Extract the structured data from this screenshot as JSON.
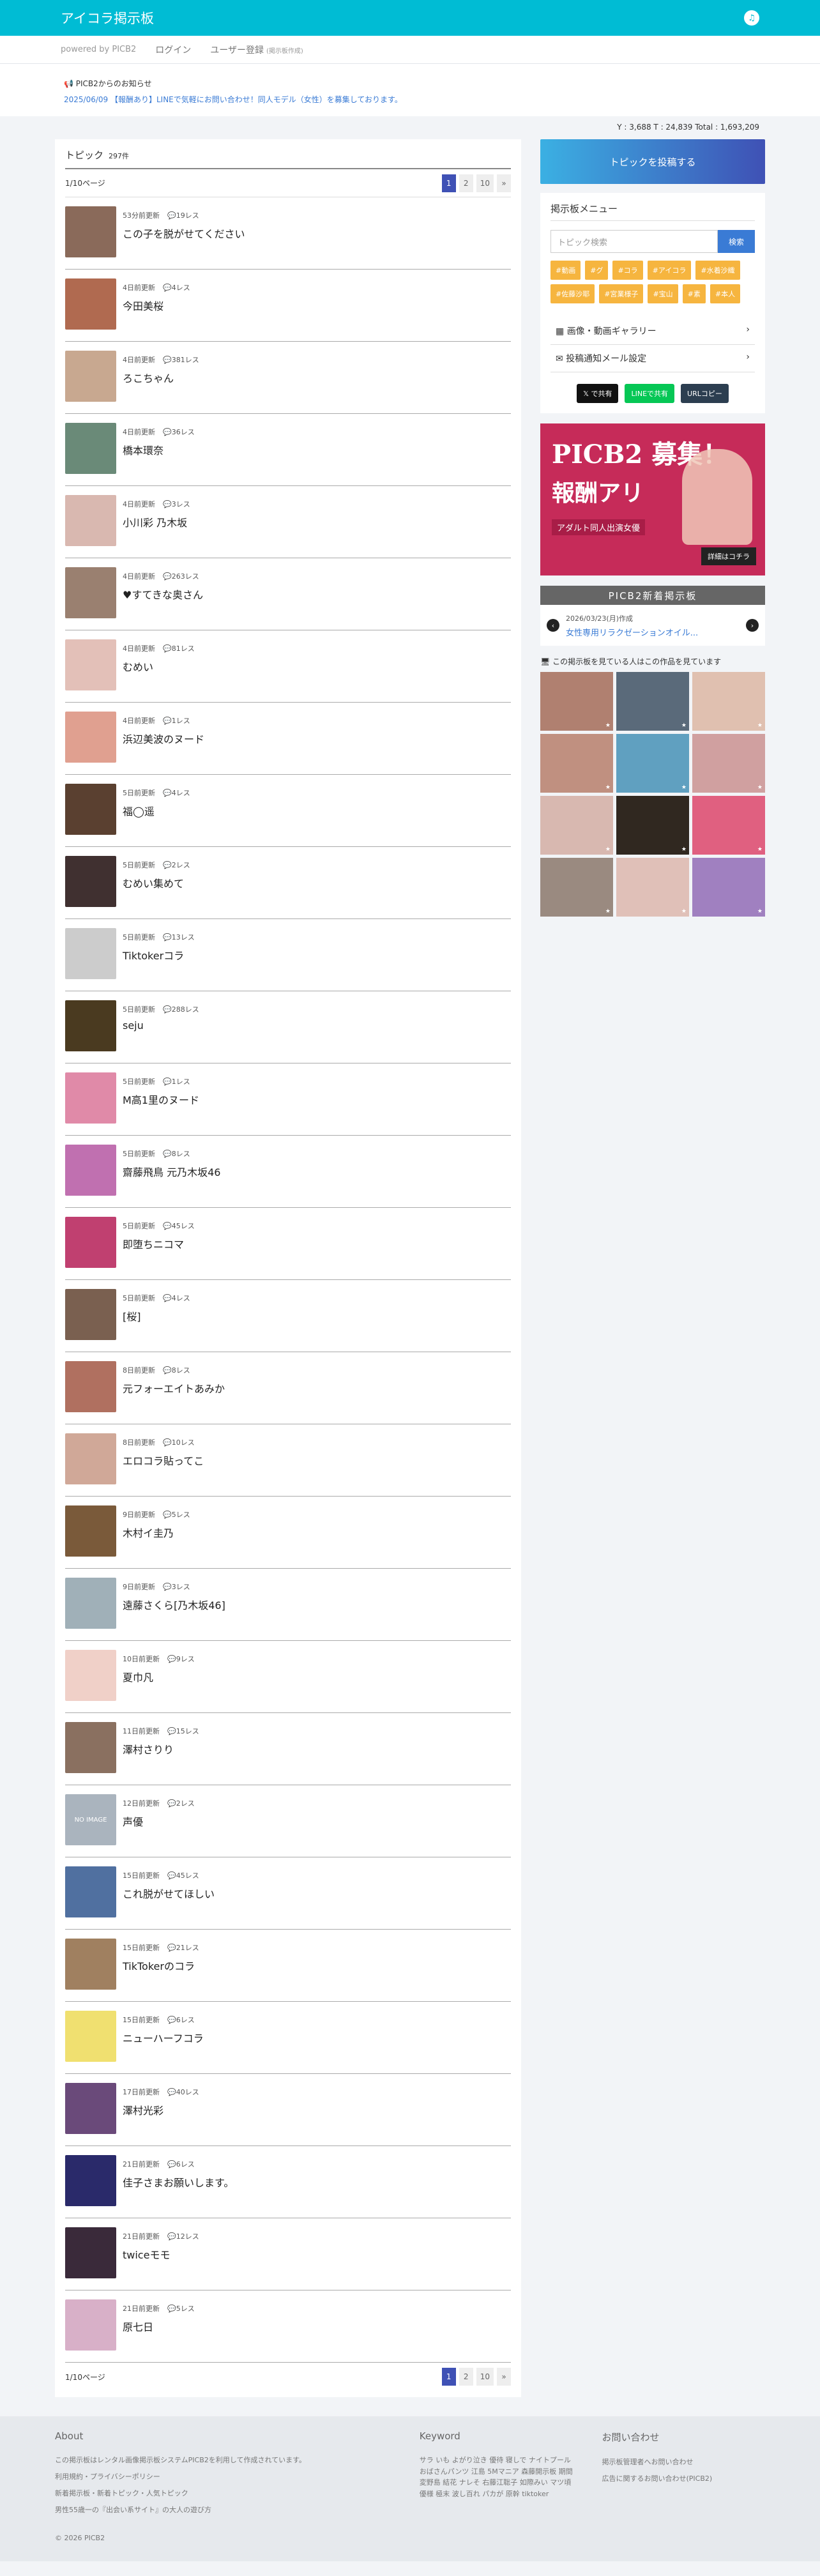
{
  "header": {
    "title": "アイコラ掲示板"
  },
  "subnav": {
    "powered": "powered by PICB2",
    "login": "ログイン",
    "register": "ユーザー登録",
    "register_note": "(掲示板作成)"
  },
  "notice": {
    "title": "PICB2からのお知らせ",
    "text": "2025/06/09 【報酬あり】LINEで気軽にお問い合わせ！同人モデル（女性）を募集しております。"
  },
  "stats": "Y : 3,688  T : 24,839  Total : 1,693,209",
  "topics": {
    "heading": "トピック",
    "count": "297件",
    "page_label": "1/10ページ",
    "pages": [
      "1",
      "2",
      "10",
      "»"
    ],
    "items": [
      {
        "meta": "53分前更新",
        "res": "19レス",
        "title": "この子を脱がせてください",
        "color": "#8a6a5a"
      },
      {
        "meta": "4日前更新",
        "res": "4レス",
        "title": "今田美桜",
        "color": "#b06a50"
      },
      {
        "meta": "4日前更新",
        "res": "381レス",
        "title": "ろこちゃん",
        "color": "#c8a890"
      },
      {
        "meta": "4日前更新",
        "res": "36レス",
        "title": "橋本環奈",
        "color": "#6a8a78"
      },
      {
        "meta": "4日前更新",
        "res": "3レス",
        "title": "小川彩 乃木坂",
        "color": "#d9b8b0"
      },
      {
        "meta": "4日前更新",
        "res": "263レス",
        "title": "♥すてきな奥さん",
        "color": "#9a8070"
      },
      {
        "meta": "4日前更新",
        "res": "81レス",
        "title": "むめい",
        "color": "#e3c0b8"
      },
      {
        "meta": "4日前更新",
        "res": "1レス",
        "title": "浜辺美波のヌード",
        "color": "#e0a090"
      },
      {
        "meta": "5日前更新",
        "res": "4レス",
        "title": "福◯遥",
        "color": "#5a4030"
      },
      {
        "meta": "5日前更新",
        "res": "2レス",
        "title": "むめい集めて",
        "color": "#403030"
      },
      {
        "meta": "5日前更新",
        "res": "13レス",
        "title": "Tiktokerコラ",
        "color": "#cccccc"
      },
      {
        "meta": "5日前更新",
        "res": "288レス",
        "title": "seju",
        "color": "#4a3a20"
      },
      {
        "meta": "5日前更新",
        "res": "1レス",
        "title": "M高1里のヌード",
        "color": "#e08aa8"
      },
      {
        "meta": "5日前更新",
        "res": "8レス",
        "title": "齋藤飛鳥 元乃木坂46",
        "color": "#c070b0"
      },
      {
        "meta": "5日前更新",
        "res": "45レス",
        "title": "即堕ちニコマ",
        "color": "#c04070"
      },
      {
        "meta": "5日前更新",
        "res": "4レス",
        "title": "[桜]",
        "color": "#7a6050"
      },
      {
        "meta": "8日前更新",
        "res": "8レス",
        "title": "元フォーエイトあみか",
        "color": "#b07060"
      },
      {
        "meta": "8日前更新",
        "res": "10レス",
        "title": "エロコラ貼ってこ",
        "color": "#d0a898"
      },
      {
        "meta": "9日前更新",
        "res": "5レス",
        "title": "木村イ圭乃",
        "color": "#7a5a3a"
      },
      {
        "meta": "9日前更新",
        "res": "3レス",
        "title": "遠藤さくら[乃木坂46]",
        "color": "#a0b0b8"
      },
      {
        "meta": "10日前更新",
        "res": "9レス",
        "title": "夏巾凡",
        "color": "#f0d0c8"
      },
      {
        "meta": "11日前更新",
        "res": "15レス",
        "title": "澤村さりり",
        "color": "#8a7060"
      },
      {
        "meta": "12日前更新",
        "res": "2レス",
        "title": "声優",
        "color": "#aab4be",
        "noimage": "NO IMAGE"
      },
      {
        "meta": "15日前更新",
        "res": "45レス",
        "title": "これ脱がせてほしい",
        "color": "#5070a0"
      },
      {
        "meta": "15日前更新",
        "res": "21レス",
        "title": "TikTokerのコラ",
        "color": "#a08060"
      },
      {
        "meta": "15日前更新",
        "res": "6レス",
        "title": "ニューハーフコラ",
        "color": "#f0e070"
      },
      {
        "meta": "17日前更新",
        "res": "40レス",
        "title": "澤村光彩",
        "color": "#6a4a7a"
      },
      {
        "meta": "21日前更新",
        "res": "6レス",
        "title": "佳子さまお願いします。",
        "color": "#2a2a6a"
      },
      {
        "meta": "21日前更新",
        "res": "12レス",
        "title": "twiceモモ",
        "color": "#3a2a3a"
      },
      {
        "meta": "21日前更新",
        "res": "5レス",
        "title": "原七日",
        "color": "#d8b0c8"
      }
    ]
  },
  "sidebar": {
    "post_button": "トピックを投稿する",
    "menu_title": "掲示板メニュー",
    "search_placeholder": "トピック検索",
    "search_button": "検索",
    "tags": [
      "#動画",
      "#グ",
      "#コラ",
      "#アイコラ",
      "#水着沙織",
      "#佐藤沙耶",
      "#宮業様子",
      "#宝山",
      "#素",
      "#本人"
    ],
    "links": [
      "画像・動画ギャラリー",
      "投稿通知メール設定"
    ],
    "shares": [
      "で共有",
      "LINEで共有",
      "URLコピー"
    ],
    "banner": {
      "line1": "PICB2 募集！",
      "line2": "報酬アリ",
      "line3": "アダルト同人出演女優",
      "cta": "詳細はコチラ"
    },
    "new_board": {
      "head": "PICB2新着掲示板",
      "date": "2026/03/23(月)作成",
      "title": "女性専用リラクゼーションオイル..."
    },
    "gallery_title": "この掲示板を見ている人はこの作品を見ています",
    "gallery_colors": [
      "#b08070",
      "#5a6a7a",
      "#e0c0b0",
      "#c09080",
      "#60a0c0",
      "#d0a0a0",
      "#d8b8b0",
      "#302820",
      "#e06080",
      "#9a8a80",
      "#e0c0b8",
      "#a080c0"
    ]
  },
  "footer": {
    "about_title": "About",
    "about_lines": [
      "この掲示板はレンタル画像掲示板システムPICB2を利用して作成されています。",
      "利用規約・プライバシーポリシー",
      "新着掲示板・新着トピック・人気トピック",
      "男性55歳一の『出会い系サイト』の大人の遊び方"
    ],
    "keyword_title": "Keyword",
    "keyword_text": "サラ いも よがり泣き 優待 寝しで ナイトプール おばさんパンツ 江島 5Mマニア 森藤開示板 期間変野島 結花 ナレそ 右藤江聡子 如際みい マツ頃優様 極末 波し百れ パカが 原幹 tiktoker",
    "contact_title": "お問い合わせ",
    "contact_lines": [
      "掲示板管理者へお問い合わせ",
      "広告に関するお問い合わせ(PICB2)"
    ],
    "copyright": "© 2026 PICB2"
  }
}
